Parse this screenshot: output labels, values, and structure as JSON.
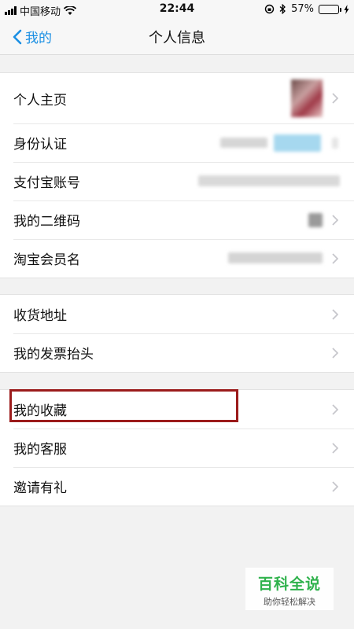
{
  "status_bar": {
    "carrier": "中国移动",
    "time": "22:44",
    "battery": "57%",
    "battery_level": 0.57
  },
  "nav": {
    "back_label": "我的",
    "title": "个人信息"
  },
  "groups": [
    {
      "rows": [
        {
          "label": "个人主页"
        },
        {
          "label": "身份认证"
        },
        {
          "label": "支付宝账号"
        },
        {
          "label": "我的二维码"
        },
        {
          "label": "淘宝会员名"
        }
      ]
    },
    {
      "rows": [
        {
          "label": "收货地址"
        },
        {
          "label": "我的发票抬头"
        }
      ]
    },
    {
      "rows": [
        {
          "label": "我的收藏"
        },
        {
          "label": "我的客服"
        },
        {
          "label": "邀请有礼"
        }
      ]
    }
  ],
  "watermark": {
    "brand": "百科全说",
    "slogan": "助你轻松解决"
  },
  "colors": {
    "accent": "#1a8fe3",
    "highlight": "#9b1b1b",
    "watermark_green": "#2fb24c"
  }
}
